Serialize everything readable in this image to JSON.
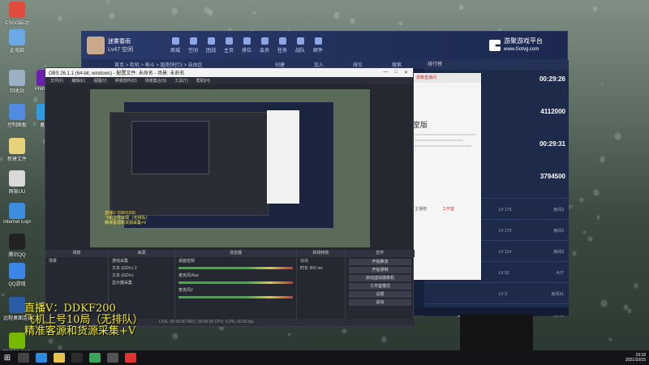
{
  "desktop": {
    "icons": [
      {
        "label": "CSGO启动",
        "color": "#e04b3b"
      },
      {
        "label": "此电脑",
        "color": "#6aa8e8"
      },
      {
        "label": "回收站",
        "color": "#9bb0c4"
      },
      {
        "label": "控制面板",
        "color": "#4f8be0"
      },
      {
        "label": "新建文件",
        "color": "#e8d27a"
      },
      {
        "label": "网易UU",
        "color": "#d9d9d9"
      },
      {
        "label": "Internet Explorer",
        "color": "#3b8ee0"
      },
      {
        "label": "腾讯QQ",
        "color": "#222222"
      },
      {
        "label": "QQ游戏",
        "color": "#3c86e8"
      },
      {
        "label": "远程桌面连接",
        "color": "#2b5ca8"
      },
      {
        "label": "NVIDIA RTX Voice",
        "color": "#76b900"
      },
      {
        "label": "Premiere",
        "color": "#6e1fb1"
      },
      {
        "label": "桌面",
        "color": "#2f9be3"
      }
    ]
  },
  "game_window": {
    "user": "迷雾春雨",
    "level": "Lv47",
    "status": "空闲",
    "nav": [
      "商城",
      "空间",
      "团战",
      "主页",
      "排位",
      "会员",
      "任务",
      "战队",
      "邮件"
    ],
    "brand_name": "游聚游戏平台",
    "brand_url": "www.Gotvg.com",
    "breadcrumb": "首页 > 街机 > 格斗 > 越南快打3 > 自由区",
    "tabs": [
      "创建",
      "加入",
      "排位",
      "搜索"
    ],
    "rank_tab": "排行榜",
    "times": [
      "00:29:26",
      "4112000",
      "00:29:31",
      "3794500"
    ],
    "rooms": [
      {
        "lv": "LV 175",
        "room": "房间3"
      },
      {
        "lv": "LV 170",
        "room": "房间3"
      },
      {
        "lv": "LV 114",
        "room": "房间3"
      },
      {
        "lv": "LV 52",
        "room": "大厅"
      },
      {
        "lv": "LV 3",
        "room": "房间31"
      },
      {
        "lv": "LV 128",
        "room": "房间3"
      }
    ],
    "room_name": "青春极恋"
  },
  "obs": {
    "title": "OBS 26.1.1 (64-bit, windows) - 配置文件: 未命名 - 场景: 未命名",
    "menu": [
      "文件(F)",
      "编辑(E)",
      "视图(V)",
      "停靠部件(D)",
      "场景集合(S)",
      "工具(T)",
      "帮助(H)"
    ],
    "docks": [
      "场景",
      "来源",
      "混音器",
      "转场特效",
      "控件"
    ],
    "scene": "场景",
    "sources": [
      "游戏采集",
      "文本 (GDI+) 2",
      "文本 (GDI+)",
      "显示器采集"
    ],
    "mixer": [
      "桌面音频",
      "麦克风/Aux",
      "麦克风2"
    ],
    "transition_fade": "淡出",
    "transition_duration_label": "时长",
    "transition_duration": "300 ms",
    "controls": [
      "开始推流",
      "开始录制",
      "启动虚拟摄像机",
      "工作室模式",
      "设置",
      "退出"
    ],
    "status": "LIVE: 00:00:00   REC: 00:00:00   CPU: 0.3%, 60.00 fps",
    "preview_caption": "直播V: DDKF200\n飞机上号10局（无排队）\n精准客源和货源采集+V"
  },
  "popup": {
    "header": "游聚直播间",
    "title": "室版",
    "bottom_left": "主播榜",
    "bottom_right": "工作室"
  },
  "overlay": {
    "line1": "直播V：DDKF200",
    "line2": "飞机上号10局（无排队）",
    "line3": "精准客源和货源采集+V"
  },
  "taskbar": {
    "time": "19:18",
    "date": "2021/10/15"
  }
}
